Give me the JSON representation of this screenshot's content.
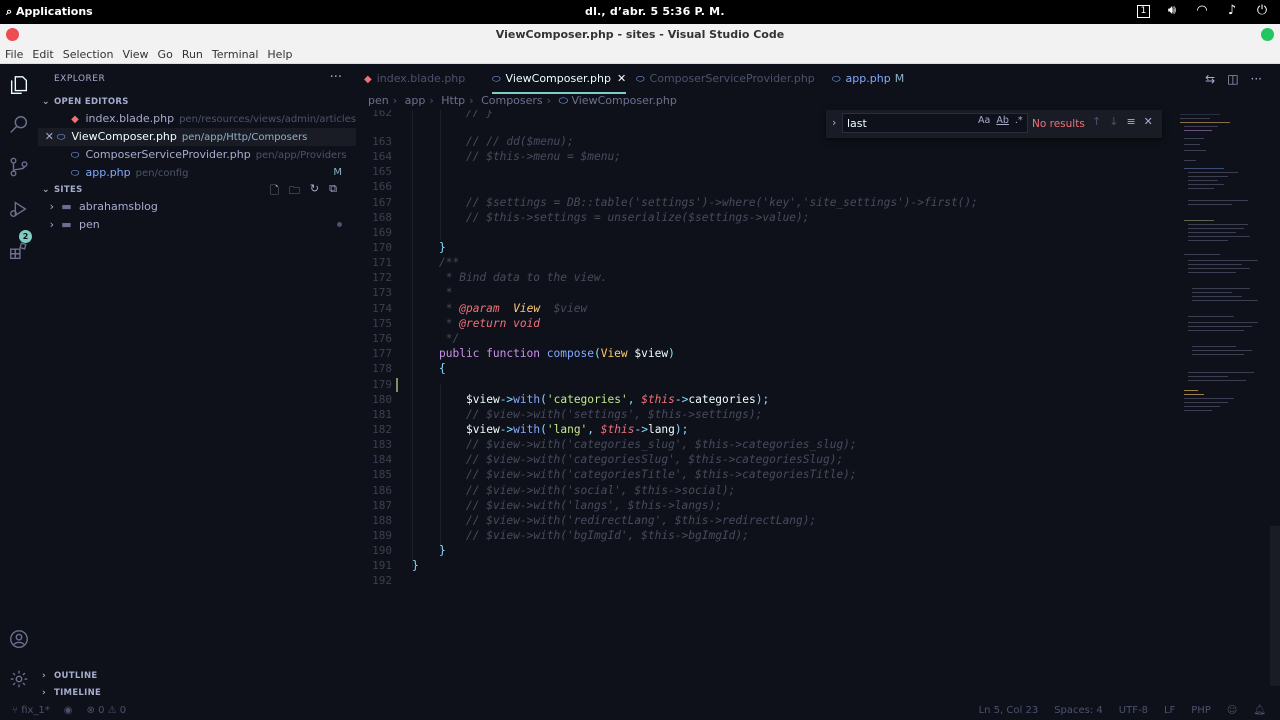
{
  "system": {
    "apps_label": "Applications",
    "clock": "dl., d’abr.  5    5:36 P. M.",
    "workspace": "1"
  },
  "window": {
    "title": "ViewComposer.php - sites - Visual Studio Code"
  },
  "menu": [
    "File",
    "Edit",
    "Selection",
    "View",
    "Go",
    "Run",
    "Terminal",
    "Help"
  ],
  "sidebar": {
    "title": "EXPLORER",
    "open_editors_label": "OPEN EDITORS",
    "open_editors": [
      {
        "name": "index.blade.php",
        "path": "pen/resources/views/admin/articles",
        "icon": "blade-icon",
        "color": "#f07178"
      },
      {
        "name": "ViewComposer.php",
        "path": "pen/app/Http/Composers",
        "icon": "php-icon",
        "color": "#82aaff",
        "active": true
      },
      {
        "name": "ComposerServiceProvider.php",
        "path": "pen/app/Providers",
        "icon": "php-icon",
        "color": "#82aaff"
      },
      {
        "name": "app.php",
        "path": "pen/config",
        "icon": "php-icon",
        "color": "#82aaff",
        "flag": "M"
      }
    ],
    "sites_label": "SITES",
    "folders": [
      "abrahamsblog",
      "pen"
    ],
    "outline_label": "OUTLINE",
    "timeline_label": "TIMELINE",
    "scm_badge": "2"
  },
  "tabs": [
    {
      "label": "index.blade.php",
      "icon": "blade-icon"
    },
    {
      "label": "ViewComposer.php",
      "icon": "php-icon",
      "active": true
    },
    {
      "label": "ComposerServiceProvider.php",
      "icon": "php-icon"
    },
    {
      "label": "app.php",
      "icon": "php-icon",
      "flag": "M"
    }
  ],
  "breadcrumb": [
    "pen",
    "app",
    "Http",
    "Composers",
    "ViewComposer.php"
  ],
  "find": {
    "value": "last",
    "match_case": "Aa",
    "whole_word": "Ab",
    "regex": ".*",
    "result": "No results"
  },
  "lines": [
    "162",
    "163",
    "164",
    "165",
    "166",
    "167",
    "168",
    "169",
    "170",
    "171",
    "172",
    "173",
    "174",
    "175",
    "176",
    "177",
    "178",
    "179",
    "180",
    "181",
    "182",
    "183",
    "184",
    "185",
    "186",
    "187",
    "188",
    "189",
    "190",
    "191",
    "192"
  ],
  "code": {
    "l162": "// }",
    "l164": "// // dd($menu);",
    "l165": "// $this->menu = $menu;",
    "l168": "// $settings = DB::table('settings')->where('key','site_settings')->first();",
    "l169": "// $this->settings = unserialize($settings->value);",
    "l171": "}",
    "l172": "/**",
    "l173": " * Bind data to the view.",
    "l174": " *",
    "l175a": " * ",
    "l175b": "@param",
    "l175c": "View",
    "l175d": "$view",
    "l176a": " * ",
    "l176b": "@return void",
    "l177": " */",
    "l178a": "public function",
    "l178b": "compose",
    "l178c": "(",
    "l178d": "View",
    "l178e": "$view",
    "l178f": ")",
    "l179": "{",
    "l181a": "$view",
    "l181b": "->",
    "l181c": "with",
    "l181d": "(",
    "l181e": "'categories'",
    "l181f": ", ",
    "l181g": "$this",
    "l181h": "->",
    "l181i": "categories",
    "l181j": ");",
    "l182": "// $view->with('settings', $this->settings);",
    "l183a": "$view",
    "l183b": "->",
    "l183c": "with",
    "l183d": "(",
    "l183e": "'lang'",
    "l183f": ", ",
    "l183g": "$this",
    "l183h": "->",
    "l183i": "lang",
    "l183j": ");",
    "l184": "// $view->with('categories_slug', $this->categories_slug);",
    "l185": "// $view->with('categoriesSlug', $this->categoriesSlug);",
    "l186": "// $view->with('categoriesTitle', $this->categoriesTitle);",
    "l187": "// $view->with('social', $this->social);",
    "l188": "// $view->with('langs', $this->langs);",
    "l189": "// $view->with('redirectLang', $this->redirectLang);",
    "l190": "// $view->with('bgImgId', $this->bgImgId);",
    "l191": "}",
    "l192": "}"
  },
  "status": {
    "branch": "fix_1*",
    "errors": "0",
    "warnings": "0",
    "position": "Ln 5, Col 23",
    "spaces": "Spaces: 4",
    "encoding": "UTF-8",
    "eol": "LF",
    "language": "PHP"
  },
  "colors": {
    "accent": "#80cbc4",
    "background": "#0f111a",
    "error": "#f07178"
  }
}
